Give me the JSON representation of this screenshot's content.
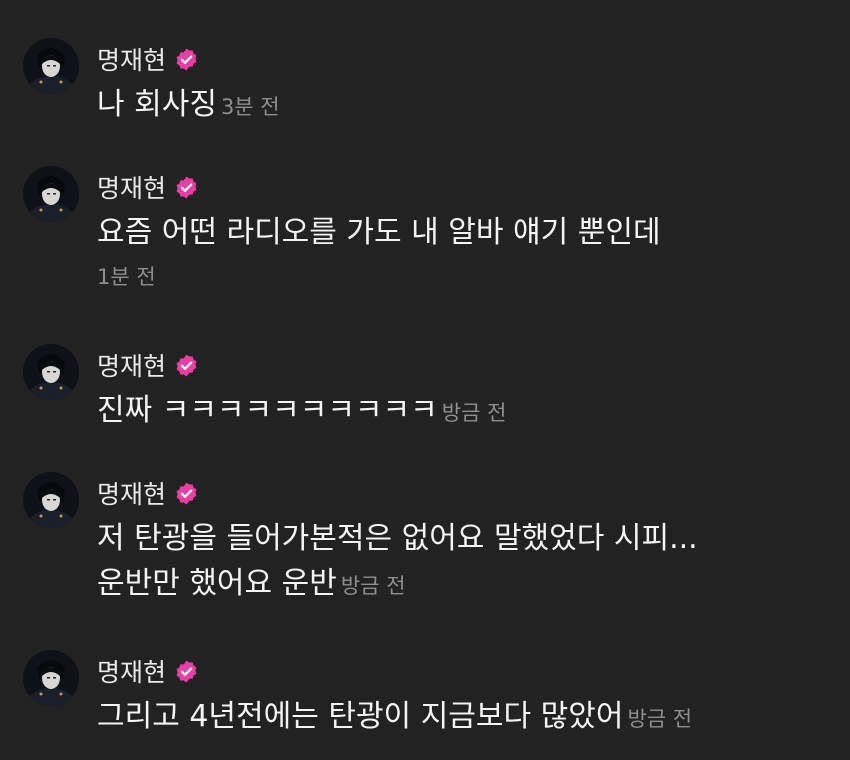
{
  "accent_colors": {
    "verified_badge": "#e83ea6",
    "background": "#222223",
    "timestamp": "#8e8e8e"
  },
  "messages": [
    {
      "author": "명재현",
      "verified_icon": "verified-check-icon",
      "text": "나 회사징",
      "time": "3분 전"
    },
    {
      "author": "명재현",
      "verified_icon": "verified-check-icon",
      "text": "요즘 어떤 라디오를 가도 내 알바 얘기 뿐인데",
      "time": "1분 전"
    },
    {
      "author": "명재현",
      "verified_icon": "verified-check-icon",
      "text": "진짜 ㅋㅋㅋㅋㅋㅋㅋㅋㅋㅋ",
      "time": "방금 전"
    },
    {
      "author": "명재현",
      "verified_icon": "verified-check-icon",
      "text_line1": "저 탄광을 들어가본적은 없어요 말했었다 시피...",
      "text_line2": "운반만 했어요 운반",
      "time": "방금 전"
    },
    {
      "author": "명재현",
      "verified_icon": "verified-check-icon",
      "text": "그리고 4년전에는 탄광이 지금보다 많았어",
      "time": "방금 전"
    }
  ]
}
